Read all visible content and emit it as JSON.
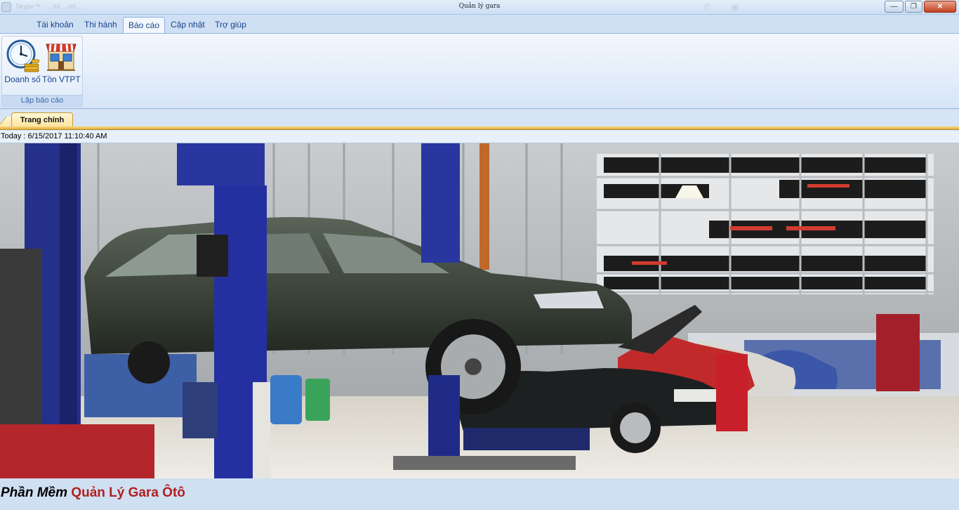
{
  "window": {
    "title": "Quản lý gara",
    "qat_text": "Skype™ - ...dd ...dd ...",
    "buttons": {
      "minimize": "—",
      "maximize": "❐",
      "close": "✕"
    }
  },
  "ribbon": {
    "tabs": [
      {
        "label": "Tài khoản"
      },
      {
        "label": "Thi hành"
      },
      {
        "label": "Báo cáo",
        "active": true
      },
      {
        "label": "Cập nhật"
      },
      {
        "label": "Trợ giúp"
      }
    ],
    "groups": [
      {
        "label": "Lập báo cáo",
        "buttons": [
          {
            "label": "Doanh số",
            "icon": "clock-coins-icon"
          },
          {
            "label": "Tồn VTPT",
            "icon": "store-icon"
          }
        ]
      }
    ]
  },
  "document": {
    "tab": "Trang chính",
    "today": "Today : 6/15/2017 11:10:40 AM"
  },
  "footer": {
    "title_part1": "Phần Mềm",
    "title_part2": "Quản Lý Gara Ôtô"
  },
  "colors": {
    "ribbon_bg": "#cfe0f4",
    "accent": "#15428b",
    "doc_tab": "#fde39a",
    "footer_red": "#b02020"
  }
}
